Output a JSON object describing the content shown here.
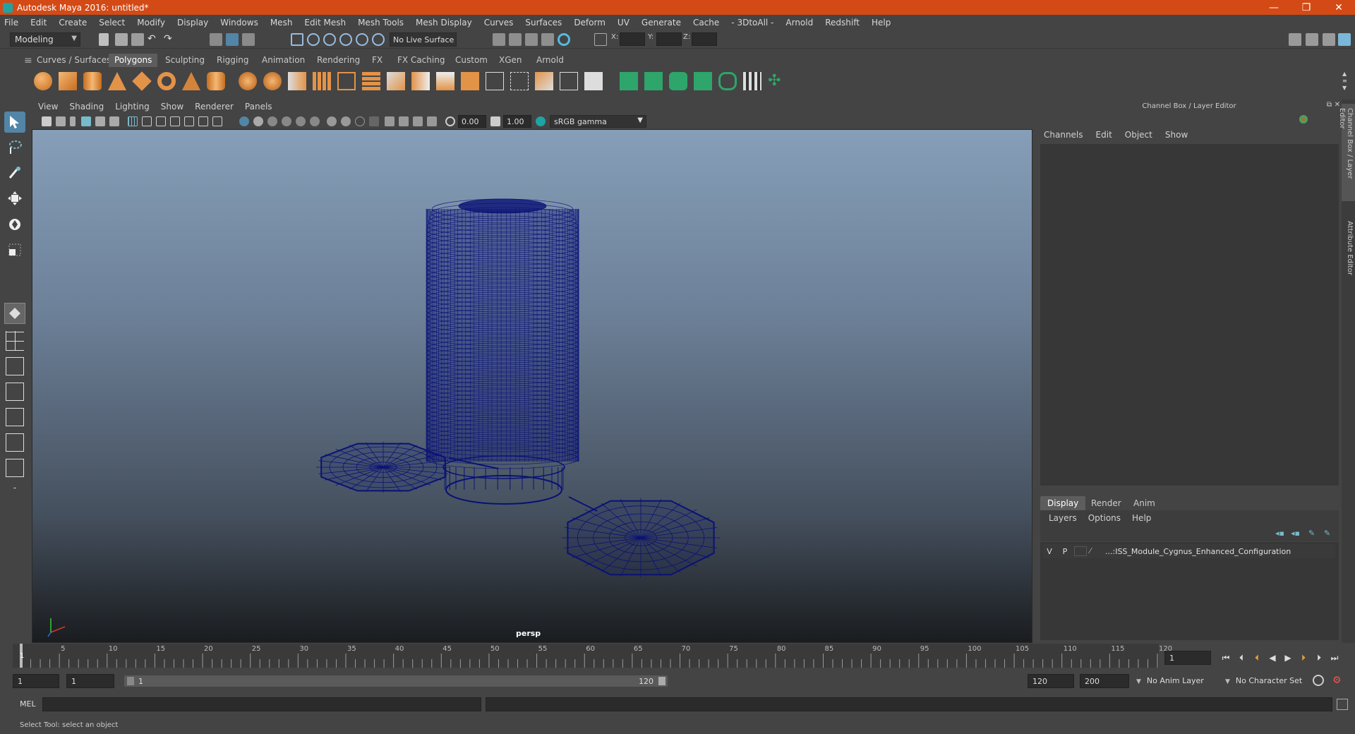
{
  "window": {
    "title": "Autodesk Maya 2016: untitled*",
    "controls": [
      "—",
      "❐",
      "✕"
    ]
  },
  "menu": [
    "File",
    "Edit",
    "Create",
    "Select",
    "Modify",
    "Display",
    "Windows",
    "Mesh",
    "Edit Mesh",
    "Mesh Tools",
    "Mesh Display",
    "Curves",
    "Surfaces",
    "Deform",
    "UV",
    "Generate",
    "Cache",
    "- 3DtoAll -",
    "Arnold",
    "Redshift",
    "Help"
  ],
  "status_line": {
    "mode": "Modeling",
    "live_surface": "No Live Surface",
    "x_label": "X:",
    "y_label": "Y:",
    "z_label": "Z:"
  },
  "shelf_tabs": [
    "Curves / Surfaces",
    "Polygons",
    "Sculpting",
    "Rigging",
    "Animation",
    "Rendering",
    "FX",
    "FX Caching",
    "Custom",
    "XGen",
    "Arnold"
  ],
  "shelf_active": "Polygons",
  "viewport": {
    "menu": [
      "View",
      "Shading",
      "Lighting",
      "Show",
      "Renderer",
      "Panels"
    ],
    "exposure": "0.00",
    "gamma_value": "1.00",
    "color_space": "sRGB gamma",
    "camera_label": "persp",
    "colors": {
      "wire": "#0a1275"
    }
  },
  "channel_box": {
    "title": "Channel Box / Layer Editor",
    "menu": [
      "Channels",
      "Edit",
      "Object",
      "Show"
    ]
  },
  "layer_editor": {
    "tabs": [
      "Display",
      "Render",
      "Anim"
    ],
    "active_tab": "Display",
    "menu": [
      "Layers",
      "Options",
      "Help"
    ],
    "layers": [
      {
        "v": "V",
        "p": "P",
        "name": "...:ISS_Module_Cygnus_Enhanced_Configuration"
      }
    ]
  },
  "side_tabs": [
    "Channel Box / Layer Editor",
    "Attribute Editor"
  ],
  "timeline": {
    "ticks": [
      "5",
      "10",
      "15",
      "20",
      "25",
      "30",
      "35",
      "40",
      "45",
      "50",
      "55",
      "60",
      "65",
      "70",
      "75",
      "80",
      "85",
      "90",
      "95",
      "100",
      "105",
      "110",
      "115",
      "120"
    ],
    "current_marker": "1",
    "current_frame": "1",
    "start": 1,
    "end": 120
  },
  "range": {
    "start_time": "1",
    "playback_start": "1",
    "range_start": "1",
    "range_end": "120",
    "playback_end": "120",
    "end_time": "200",
    "anim_layer": "No Anim Layer",
    "character_set": "No Character Set"
  },
  "command_line": {
    "label": "MEL"
  },
  "help_line": "Select Tool: select an object"
}
